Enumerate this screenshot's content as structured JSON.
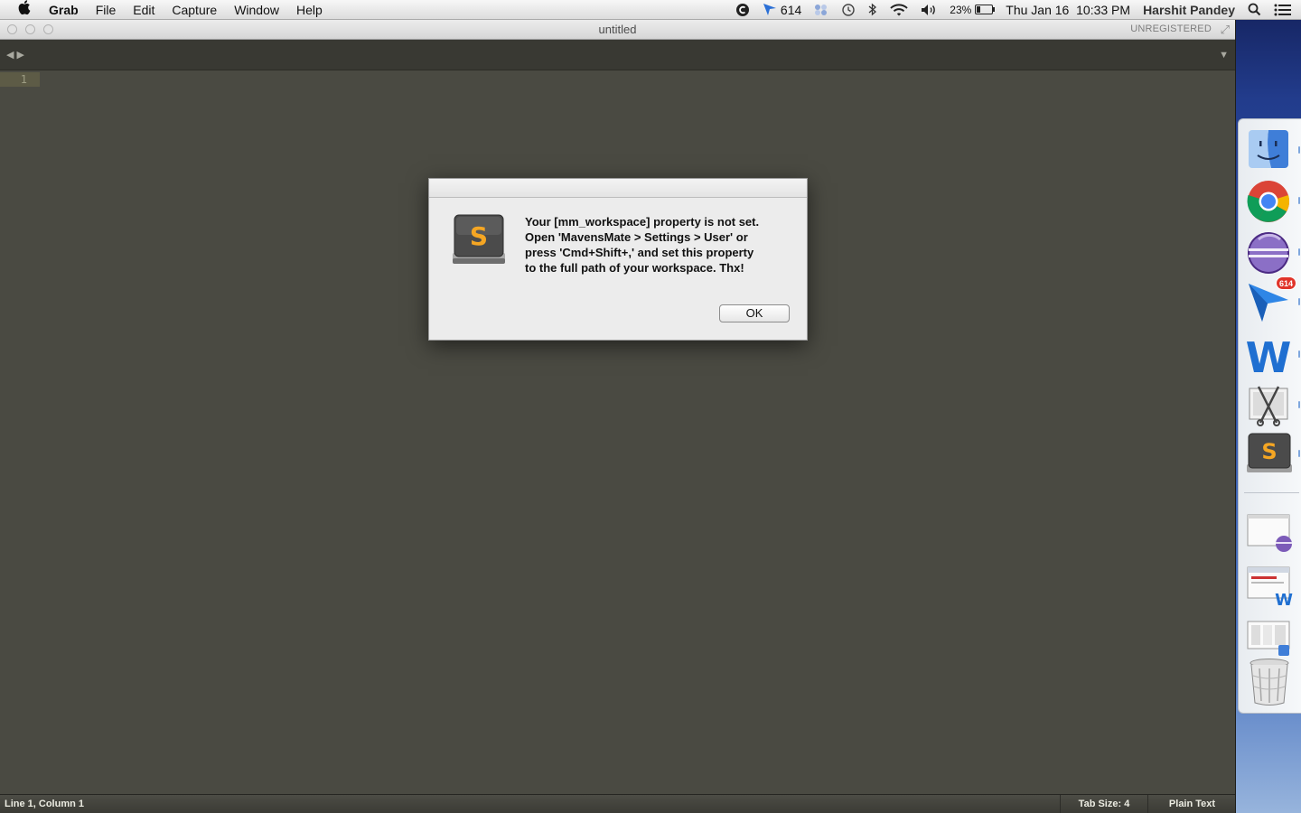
{
  "menubar": {
    "apple_icon": "apple-icon",
    "items": [
      "Grab",
      "File",
      "Edit",
      "Capture",
      "Window",
      "Help"
    ],
    "status": {
      "sparrow_count": "614",
      "battery": "23%",
      "battery_level": 0.23,
      "datetime": "Thu Jan 16  10:33 PM",
      "user": "Harshit Pandey"
    }
  },
  "window": {
    "title": "untitled",
    "registration": "UNREGISTERED",
    "line_number": "1",
    "status_left": "Line 1, Column 1",
    "tab_size": "Tab Size: 4",
    "syntax": "Plain Text"
  },
  "dialog": {
    "message_lines": [
      "Your [mm_workspace] property is not set.",
      "Open 'MavensMate > Settings > User' or",
      "press 'Cmd+Shift+,' and set this property",
      "to the full path of your workspace. Thx!"
    ],
    "ok_label": "OK"
  },
  "dock": {
    "apps": [
      {
        "name": "Finder",
        "icon": "finder-icon"
      },
      {
        "name": "Google Chrome",
        "icon": "chrome-icon"
      },
      {
        "name": "Eclipse",
        "icon": "eclipse-icon"
      },
      {
        "name": "Sparrow",
        "icon": "sparrow-icon",
        "badge": "614"
      },
      {
        "name": "Microsoft Word",
        "icon": "word-icon"
      },
      {
        "name": "Grab",
        "icon": "grab-icon"
      },
      {
        "name": "Sublime Text",
        "icon": "sublime-icon"
      }
    ],
    "minimized": [
      "eclipse-window",
      "word-window",
      "finder-window"
    ],
    "trash_icon": "trash-icon"
  },
  "colors": {
    "editor_bg": "#4a4a42",
    "gutter_highlight": "#5d5b46",
    "badge": "#e0342a",
    "sublime_orange": "#f5a623"
  }
}
